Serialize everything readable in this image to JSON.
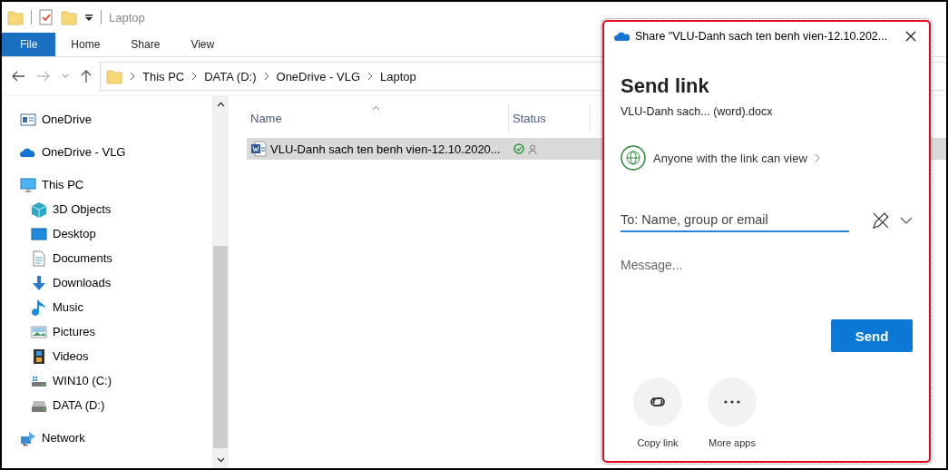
{
  "window": {
    "title": "Laptop"
  },
  "ribbon_tabs": [
    {
      "label": "File",
      "selected": true
    },
    {
      "label": "Home",
      "selected": false
    },
    {
      "label": "Share",
      "selected": false
    },
    {
      "label": "View",
      "selected": false
    }
  ],
  "breadcrumb": [
    "This PC",
    "DATA (D:)",
    "OneDrive - VLG",
    "Laptop"
  ],
  "sidebar": {
    "items": [
      {
        "label": "OneDrive",
        "kind": "cardfile"
      },
      {
        "label": "OneDrive - VLG",
        "kind": "cloud"
      },
      {
        "label": "This PC",
        "kind": "computer",
        "children": [
          {
            "label": "3D Objects",
            "kind": "cube"
          },
          {
            "label": "Desktop",
            "kind": "monitor"
          },
          {
            "label": "Documents",
            "kind": "document"
          },
          {
            "label": "Downloads",
            "kind": "download"
          },
          {
            "label": "Music",
            "kind": "note"
          },
          {
            "label": "Pictures",
            "kind": "image"
          },
          {
            "label": "Videos",
            "kind": "film"
          },
          {
            "label": "WIN10 (C:)",
            "kind": "systemdrive"
          },
          {
            "label": "DATA (D:)",
            "kind": "drive"
          }
        ]
      },
      {
        "label": "Network",
        "kind": "network"
      }
    ]
  },
  "table": {
    "columns": [
      "Name",
      "Status"
    ],
    "rows": [
      {
        "name": "VLU-Danh sach ten benh vien-12.10.2020...",
        "selected": true
      }
    ]
  },
  "share_dialog": {
    "title": "Share \"VLU-Danh sach ten benh vien-12.10.202...",
    "heading": "Send link",
    "file_name": "VLU-Danh sach... (word).docx",
    "permission": "Anyone with the link can view",
    "to_placeholder": "To: Name, group or email",
    "message_placeholder": "Message...",
    "send_button": "Send",
    "actions": [
      {
        "label": "Copy link",
        "kind": "link"
      },
      {
        "label": "More apps",
        "kind": "more"
      }
    ]
  }
}
